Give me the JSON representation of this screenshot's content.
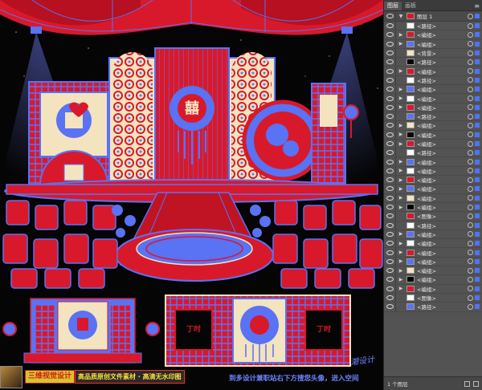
{
  "panel": {
    "tabs": [
      "图层",
      "画板"
    ],
    "menu_icon": "panel-menu-icon",
    "group_label": "图层 1",
    "layers": [
      "<路径>",
      "<编组>",
      "<编组>",
      "<背景>",
      "<路径>",
      "<编组>",
      "<路径>",
      "<编组>",
      "<编组>",
      "<编组>",
      "<路径>",
      "<编组>",
      "<编组>",
      "<编组>",
      "<路径>",
      "<编组>",
      "<编组>",
      "<编组>",
      "<编组>",
      "<编组>",
      "<编组>",
      "<图像>",
      "<路径>",
      "<编组>",
      "<编组>",
      "<编组>",
      "<编组>",
      "<编组>",
      "<编组>",
      "<编组>",
      "<图像>",
      "<路径>"
    ],
    "footer": "1 个图层"
  },
  "ad": {
    "badge1": "三维视觉设计",
    "badge2": "高品质原创文件素材 · 高清无水印图",
    "text": "到多设计兼职站右下方搜您头像，进入空间",
    "signature": "潮设计"
  },
  "stage": {
    "left_sign": "丁时",
    "right_sign": "丁时"
  },
  "colors": {
    "red": "#d8192b",
    "blue": "#5a72f4",
    "cream": "#f3e3bf",
    "panel": "#535353"
  }
}
